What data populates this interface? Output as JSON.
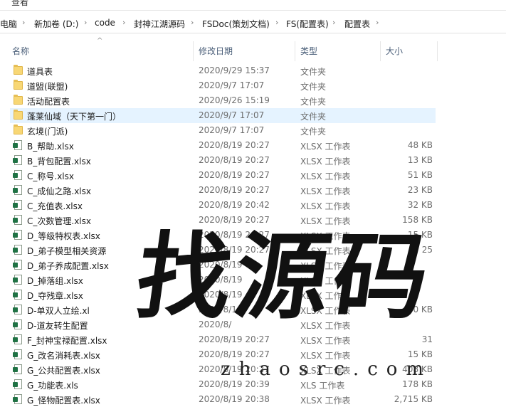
{
  "ribbon": {
    "label": "查看"
  },
  "breadcrumb": {
    "items": [
      "电脑",
      "新加卷 (D:)",
      "code",
      "封神江湖源码",
      "FSDoc(策划文档)",
      "FS(配置表)",
      "配置表"
    ]
  },
  "columns": {
    "name": "名称",
    "date": "修改日期",
    "type": "类型",
    "size": "大小"
  },
  "files": [
    {
      "name": "道具表",
      "date": "2020/9/29 15:37",
      "type": "文件夹",
      "size": "",
      "kind": "folder"
    },
    {
      "name": "道盟(联盟)",
      "date": "2020/9/7 17:07",
      "type": "文件夹",
      "size": "",
      "kind": "folder"
    },
    {
      "name": "活动配置表",
      "date": "2020/9/26 15:19",
      "type": "文件夹",
      "size": "",
      "kind": "folder"
    },
    {
      "name": "蓬莱仙域（天下第一门）",
      "date": "2020/9/7 17:07",
      "type": "文件夹",
      "size": "",
      "kind": "folder"
    },
    {
      "name": "玄境(门派)",
      "date": "2020/9/7 17:07",
      "type": "文件夹",
      "size": "",
      "kind": "folder"
    },
    {
      "name": "B_帮助.xlsx",
      "date": "2020/8/19 20:27",
      "type": "XLSX 工作表",
      "size": "48 KB",
      "kind": "xlsx"
    },
    {
      "name": "B_背包配置.xlsx",
      "date": "2020/8/19 20:27",
      "type": "XLSX 工作表",
      "size": "13 KB",
      "kind": "xlsx"
    },
    {
      "name": "C_称号.xlsx",
      "date": "2020/8/19 20:27",
      "type": "XLSX 工作表",
      "size": "51 KB",
      "kind": "xlsx"
    },
    {
      "name": "C_成仙之路.xlsx",
      "date": "2020/8/19 20:27",
      "type": "XLSX 工作表",
      "size": "23 KB",
      "kind": "xlsx"
    },
    {
      "name": "C_充值表.xlsx",
      "date": "2020/8/19 20:42",
      "type": "XLSX 工作表",
      "size": "32 KB",
      "kind": "xlsx"
    },
    {
      "name": "C_次数管理.xlsx",
      "date": "2020/8/19 20:27",
      "type": "XLSX 工作表",
      "size": "158 KB",
      "kind": "xlsx"
    },
    {
      "name": "D_等级特权表.xlsx",
      "date": "2020/8/19 20:27",
      "type": "XLSX 工作表",
      "size": "15 KB",
      "kind": "xlsx"
    },
    {
      "name": "D_弟子模型相关资源",
      "date": "2020/8/19 20:27",
      "type": "XLSX 工作表",
      "size": "25",
      "kind": "xlsx"
    },
    {
      "name": "D_弟子养成配置.xlsx",
      "date": "2020/8/19",
      "type": "XLSX 工作表",
      "size": "",
      "kind": "xlsx"
    },
    {
      "name": "D_掉落组.xlsx",
      "date": "2020/8/19",
      "type": "XLSX 工作表",
      "size": "",
      "kind": "xlsx"
    },
    {
      "name": "D_夺残章.xlsx",
      "date": "2020/8/19",
      "type": "XLSX 工作表",
      "size": "",
      "kind": "xlsx"
    },
    {
      "name": "D-单双人立绘.xl",
      "date": "2020/8/1",
      "type": "XLSX 工作表",
      "size": "0 KB",
      "kind": "xlsx"
    },
    {
      "name": "D-道友转生配置",
      "date": "2020/8/",
      "type": "XLSX 工作表",
      "size": "",
      "kind": "xlsx"
    },
    {
      "name": "F_封神宝禄配置.xlsx",
      "date": "2020/8/19 20:27",
      "type": "XLSX 工作表",
      "size": "31",
      "kind": "xlsx"
    },
    {
      "name": "G_改名消耗表.xlsx",
      "date": "2020/8/19 20:27",
      "type": "XLSX 工作表",
      "size": "15 KB",
      "kind": "xlsx"
    },
    {
      "name": "G_公共配置表.xlsx",
      "date": "2020/8/19 20:27",
      "type": "XLSX 工作表",
      "size": "408 KB",
      "kind": "xlsx"
    },
    {
      "name": "G_功能表.xls",
      "date": "2020/8/19 20:39",
      "type": "XLS 工作表",
      "size": "178 KB",
      "kind": "xlsx"
    },
    {
      "name": "G_怪物配置表.xlsx",
      "date": "2020/8/19 20:38",
      "type": "XLSX 工作表",
      "size": "2,715 KB",
      "kind": "xlsx"
    }
  ],
  "selected_index": 3,
  "watermark": {
    "big": "找源码",
    "small": "zhaosrc.com"
  }
}
